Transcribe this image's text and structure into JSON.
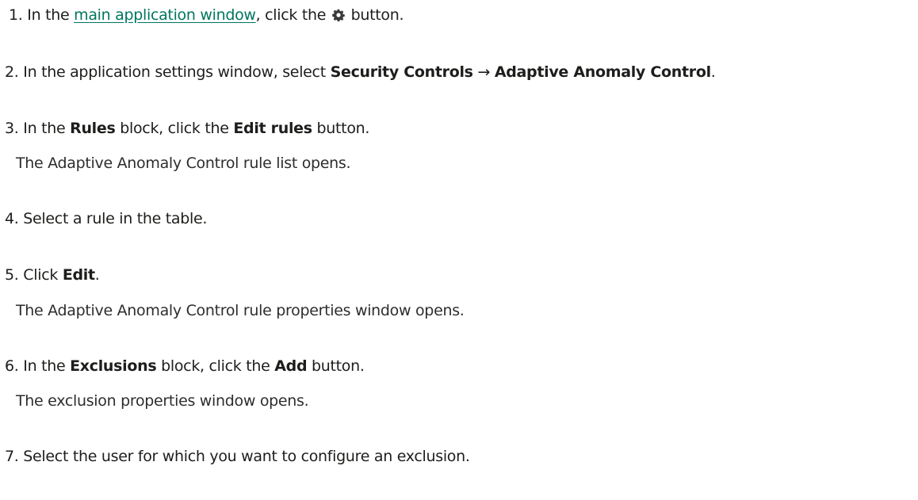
{
  "steps": [
    {
      "number": "1.",
      "pre": "In the",
      "link_text": "main application window",
      "mid": ", click the",
      "icon": "gear-icon",
      "post": "button."
    },
    {
      "number": "2.",
      "pre": "In the application settings window, select",
      "bold1": "Security Controls",
      "arrow": "→",
      "bold2": "Adaptive Anomaly Control",
      "post": "."
    },
    {
      "number": "3.",
      "pre": "In the",
      "bold1": "Rules",
      "mid": "block, click the",
      "bold2": "Edit rules",
      "post": "button.",
      "note": "The Adaptive Anomaly Control rule list opens."
    },
    {
      "number": "4.",
      "text": "Select a rule in the table."
    },
    {
      "number": "5.",
      "pre": "Click",
      "bold1": "Edit",
      "post": ".",
      "note": "The Adaptive Anomaly Control rule properties window opens."
    },
    {
      "number": "6.",
      "pre": "In the",
      "bold1": "Exclusions",
      "mid": "block, click the",
      "bold2": "Add",
      "post": "button.",
      "note": "The exclusion properties window opens."
    },
    {
      "number": "7.",
      "text": "Select the user for which you want to configure an exclusion."
    }
  ],
  "colors": {
    "link": "#00765f",
    "text": "#1d1d1b"
  }
}
